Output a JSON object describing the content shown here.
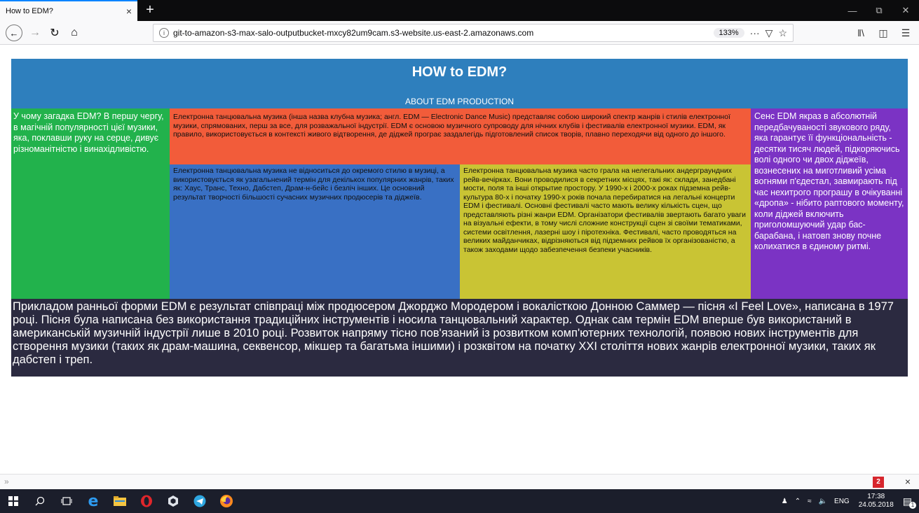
{
  "browser": {
    "tab_title": "How to EDM?",
    "tab_close": "×",
    "new_tab": "+",
    "url": "git-to-amazon-s3-max-salo-outputbucket-mxcy82um9cam.s3-website.us-east-2.amazonaws.com",
    "zoom": "133%",
    "page_actions": "···"
  },
  "page": {
    "title": "HOW to EDM?",
    "subtitle": "ABOUT EDM PRODUCTION",
    "left_text": "У чому загадка EDM? В першу чергу, в магічній популярності цієї музики, яка, поклавши руку на серце, дивує різноманітністю і винахідливістю.",
    "red_text": "Електронна танцювальна музика (інша назва клубна музика; англ. EDM — Electronic Dance Music) представляє собою широкий спектр жанрів і стилів електронної музики, спрямованих, перш за все, для розважальної індустрії. EDM є основою музичного супроводу для нічних клубів і фестивалів електронної музики. EDM, як правило, використовується в контексті живого відтворення, де діджей програє заздалегідь підготовлений список творів, плавно переходячи від одного до іншого.",
    "blue_text": "Електронна танцювальна музика не відноситься до окремого стилю в музиці, а використовується як узагальнений термін для декількох популярних жанрів, таких як: Хаус, Транс, Техно, Дабстеп, Драм-н-бейс і безліч інших. Це основний результат творчості більшості сучасних музичних продюсерів та діджеїв.",
    "yellow_text": "Електронна танцювальна музика часто грала на нелегальних андерграундних рейв-вечірках. Вони проводилися в секретних місцях, такі як: склади, занедбані мости, поля та інші открытие простору. У 1990-х і 2000-х роках підземна рейв-культура 80-х і початку 1990-х років почала перебиратися на легальні концерти EDM і фестивалі. Основні фестивалі часто мають велику кількість сцен, що представляють різні жанри EDM. Організатори фестивалів звертають багато уваги на візуальні ефекти, в тому числі сложние конструкції сцен зі своїми тематиками, системи освітлення, лазерні шоу і піротехніка. Фестивалі, часто проводяться на великих майданчиках, відрізняються від підземних рейвов їх організованістю, а також заходами щодо забезпечення безпеки учасників.",
    "right_text": "Сенс EDM якраз в абсолютній передбачуваності звукового ряду, яка гарантує її функціональність - десятки тисяч людей, підкоряючись волі одного чи двох діджеїв, вознесених на миготливий усіма вогнями п'єдестал, завмирають під час нехитрого програшу в очікуванні «дропа» - нібито раптового моменту, коли діджей включить приголомшуючий удар бас-барабана, і натовп знову почне колихатися в єдиному ритмі.",
    "footer_text": "Прикладом ранньої форми EDM є результат співпраці між продюсером Джорджо Мородером і вокалісткою Донною Саммер — пісня «I Feel Love», написана в 1977 році. Пісня була написана без використання традиційних інструментів і носила танцювальний характер. Однак сам термін EDM вперше був використаний в американській музичній індустрії лише в 2010 році. Розвиток напряму тісно пов'язаний із розвитком комп'ютерних технологій, появою нових інструментів для створення музики (таких як драм-машина, секвенсор, мікшер та багатьма іншими) і розквітом на початку XXI століття нових жанрів електронної музики, таких як дабстеп і треп."
  },
  "statusbar": {
    "badge": "2",
    "chevron": "»",
    "close": "×"
  },
  "taskbar": {
    "lang": "ENG",
    "time": "17:38",
    "date": "24.05.2018",
    "notification_count": "1"
  },
  "colors": {
    "header": "#2e7fbd",
    "left": "#22b24c",
    "red": "#f25c3a",
    "blue": "#3970c4",
    "yellow": "#c9c434",
    "right": "#7b33c4",
    "footer": "#2b2a40"
  }
}
